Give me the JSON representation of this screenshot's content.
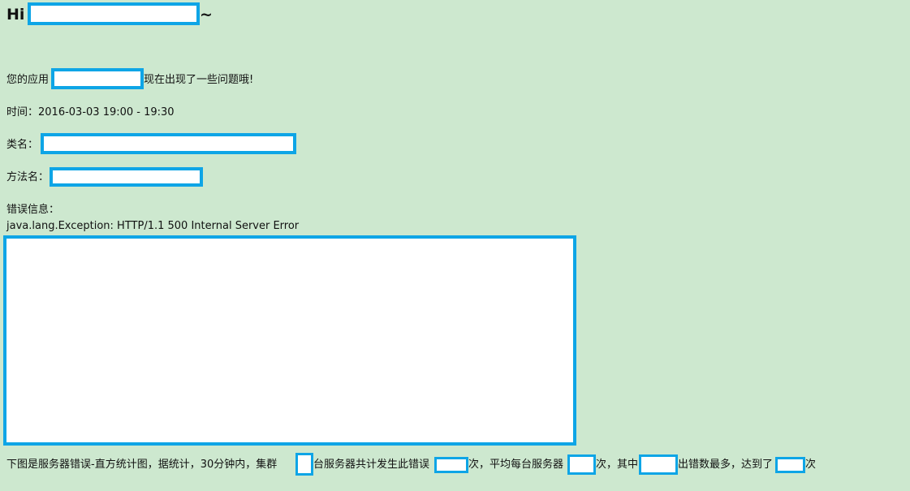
{
  "greeting": {
    "prefix": "Hi",
    "suffix": "~"
  },
  "intro": {
    "before": "您的应用",
    "after": "现在出现了一些问题哦!"
  },
  "time": {
    "label": "时间：",
    "value": "2016-03-03 19:00 - 19:30"
  },
  "class_name": {
    "label": "类名："
  },
  "method_name": {
    "label": "方法名："
  },
  "error_info": {
    "label": "错误信息：",
    "exception": "java.lang.Exception: HTTP/1.1 500 Internal Server Error"
  },
  "summary": {
    "part1": "下图是服务器错误-直方统计图，据统计，30分钟内，集群",
    "part2": "台服务器共计发生此错误",
    "part3": "次，平均每台服务器",
    "part4": "次，其中",
    "part5": "出错数最多，达到了",
    "part6": "次"
  },
  "colors": {
    "background": "#cde8cf",
    "redaction_border": "#0ea5e6",
    "redaction_fill": "#ffffff"
  }
}
